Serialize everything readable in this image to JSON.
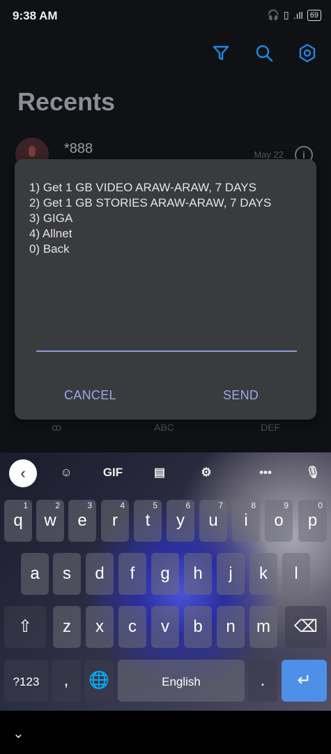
{
  "status": {
    "time": "9:38 AM",
    "battery": "69"
  },
  "page": {
    "title": "Recents"
  },
  "recent": {
    "name": "*888",
    "date": "May 22"
  },
  "dialpad": {
    "voicemail": "ꝏ",
    "abc": "ABC",
    "def": "DEF"
  },
  "dialog": {
    "lines": [
      "1) Get 1 GB VIDEO ARAW-ARAW, 7 DAYS",
      "2) Get 1 GB STORIES ARAW-ARAW, 7 DAYS",
      "3) GIGA",
      "4) Allnet",
      "0) Back"
    ],
    "input_value": "",
    "cancel": "CANCEL",
    "send": "SEND"
  },
  "keyboard": {
    "toolbar": {
      "gif": "GIF"
    },
    "row1": [
      {
        "k": "q",
        "n": "1"
      },
      {
        "k": "w",
        "n": "2"
      },
      {
        "k": "e",
        "n": "3"
      },
      {
        "k": "r",
        "n": "4"
      },
      {
        "k": "t",
        "n": "5"
      },
      {
        "k": "y",
        "n": "6"
      },
      {
        "k": "u",
        "n": "7"
      },
      {
        "k": "i",
        "n": "8"
      },
      {
        "k": "o",
        "n": "9"
      },
      {
        "k": "p",
        "n": "0"
      }
    ],
    "row2": [
      "a",
      "s",
      "d",
      "f",
      "g",
      "h",
      "j",
      "k",
      "l"
    ],
    "row3": [
      "z",
      "x",
      "c",
      "v",
      "b",
      "n",
      "m"
    ],
    "num_key": "?123",
    "comma_key": ",",
    "space_label": "English",
    "period_key": "."
  },
  "colors": {
    "accent": "#1e88e5",
    "dialog_button": "#9aa8ea",
    "enter_key": "#4e8fe8"
  }
}
